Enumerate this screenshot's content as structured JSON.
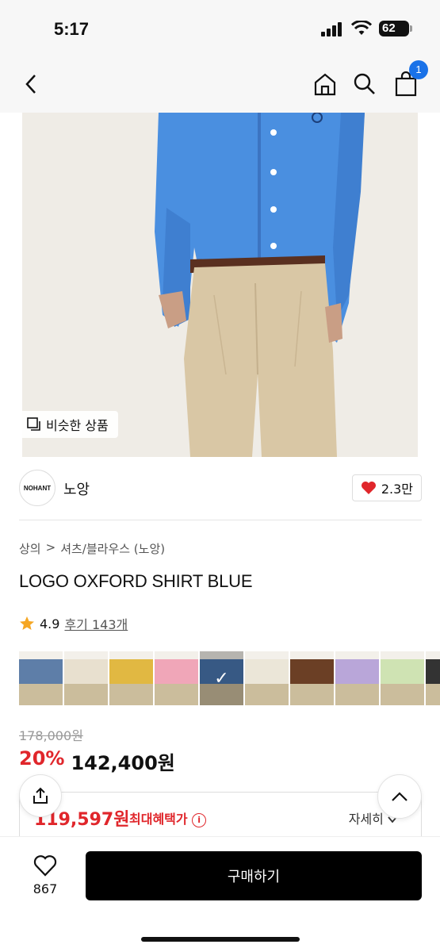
{
  "status_bar": {
    "time": "5:17",
    "battery": "62"
  },
  "nav": {
    "cart_count": "1"
  },
  "hero": {
    "similar_label": "비슷한 상품"
  },
  "brand": {
    "logo_text": "NOHANT",
    "name": "노앙",
    "likes": "2.3만"
  },
  "breadcrumb": [
    "상의",
    ">",
    "셔츠/블라우스 (노앙)"
  ],
  "product": {
    "title": "LOGO OXFORD SHIRT BLUE",
    "rating": "4.9",
    "reviews": "후기 143개",
    "original_price": "178,000원",
    "discount": "20%",
    "price": "142,400원"
  },
  "benefit": {
    "price": "119,597원",
    "label": "최대혜택가",
    "detail": "자세히"
  },
  "bottom": {
    "wish_count": "867",
    "buy_label": "구매하기"
  },
  "colors": {
    "accent": "#e0262b",
    "badge": "#1a72e8",
    "shirt": "#4a8fe0",
    "pants": "#d9c7a5"
  },
  "thumbnails": [
    {
      "color": "#5e7ea8"
    },
    {
      "color": "#e8e0cf"
    },
    {
      "color": "#e1b842"
    },
    {
      "color": "#f0a6b8"
    },
    {
      "color": "#4a77b0"
    },
    {
      "color": "#ebe6d8"
    },
    {
      "color": "#6b3f25"
    },
    {
      "color": "#b9a6d9"
    },
    {
      "color": "#cfe3b3"
    },
    {
      "color": "#333"
    }
  ]
}
